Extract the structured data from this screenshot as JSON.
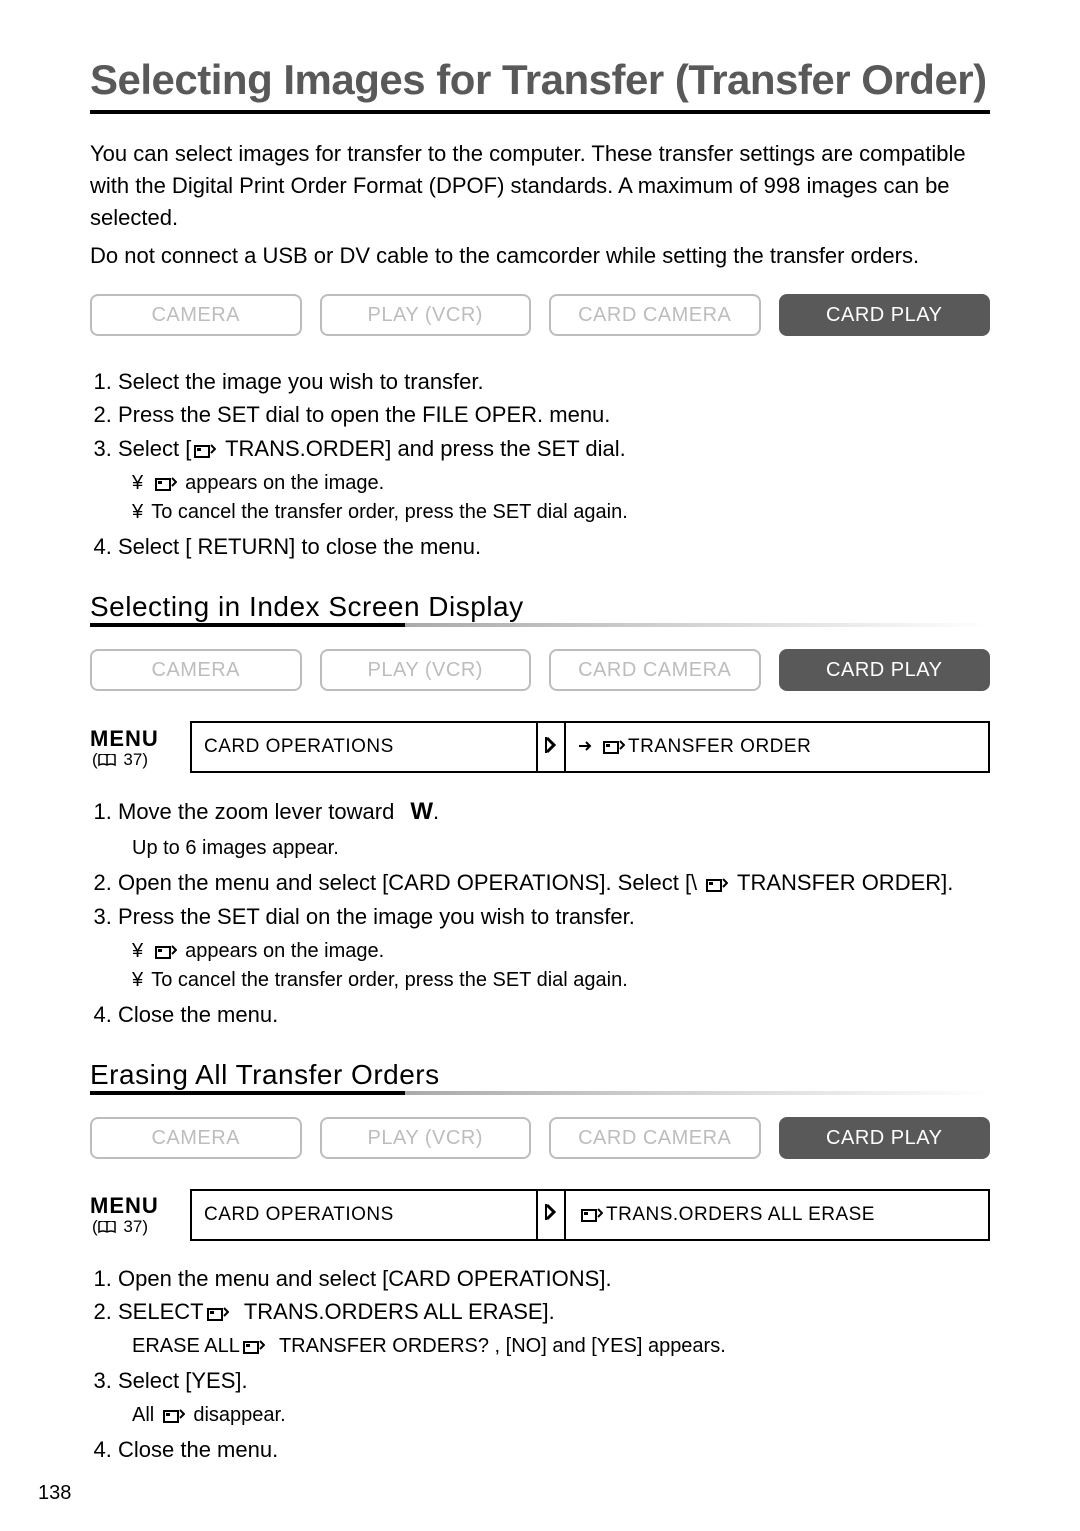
{
  "title": "Selecting Images for Transfer (Transfer Order)",
  "intro1": "You can select images for transfer to the computer. These transfer settings are compatible with the Digital Print Order Format (DPOF) standards. A maximum of 998 images can be selected.",
  "intro2": "Do not connect a USB or DV cable to the camcorder while setting the transfer orders.",
  "modes": {
    "camera": "CAMERA",
    "play_vcr": "PLAY (VCR)",
    "card_camera": "CARD CAMERA",
    "card_play": "CARD PLAY"
  },
  "section1_steps": {
    "s1": "Select the image you wish to transfer.",
    "s2": "Press the SET dial to open the FILE OPER. menu.",
    "s3": "Select [      TRANS.ORDER] and press the SET dial.",
    "s3_sub1": "appears on the image.",
    "s3_sub2": "To cancel the transfer order, press the SET dial again.",
    "s4": "Select [     RETURN] to close the menu."
  },
  "heading2": "Selecting in Index Screen Display",
  "menu": {
    "label": "MENU",
    "ref": "37",
    "cell1": "CARD OPERATIONS",
    "cell2a": "TRANSFER ORDER",
    "cell2b": "TRANS.ORDERS ALL ERASE"
  },
  "section2_steps": {
    "s1": "Move the zoom lever toward",
    "s1_w": "W",
    "s1_dot": ".",
    "s1_sub": "Up to 6 images appear.",
    "s2a": "Open the menu and select [CARD OPERATIONS]. Select [\\",
    "s2b": "TRANSFER ORDER].",
    "s3": "Press the SET dial on the image you wish to transfer.",
    "s3_sub1": "appears on the image.",
    "s3_sub2": "To cancel the transfer order, press the SET dial again.",
    "s4": "Close the menu."
  },
  "heading3": "Erasing All Transfer Orders",
  "section3_steps": {
    "s1": "Open the menu and select [CARD OPERATIONS].",
    "s2": "SELECT      TRANS.ORDERS ALL ERASE].",
    "s2_sub": "ERASE ALL      TRANSFER ORDERS? , [NO] and [YES] appears.",
    "s3": "Select [YES].",
    "s3_sub": "disappear.",
    "s3_sub_pre": "All",
    "s4": "Close the menu."
  },
  "page_number": "138",
  "bullet": "¥"
}
